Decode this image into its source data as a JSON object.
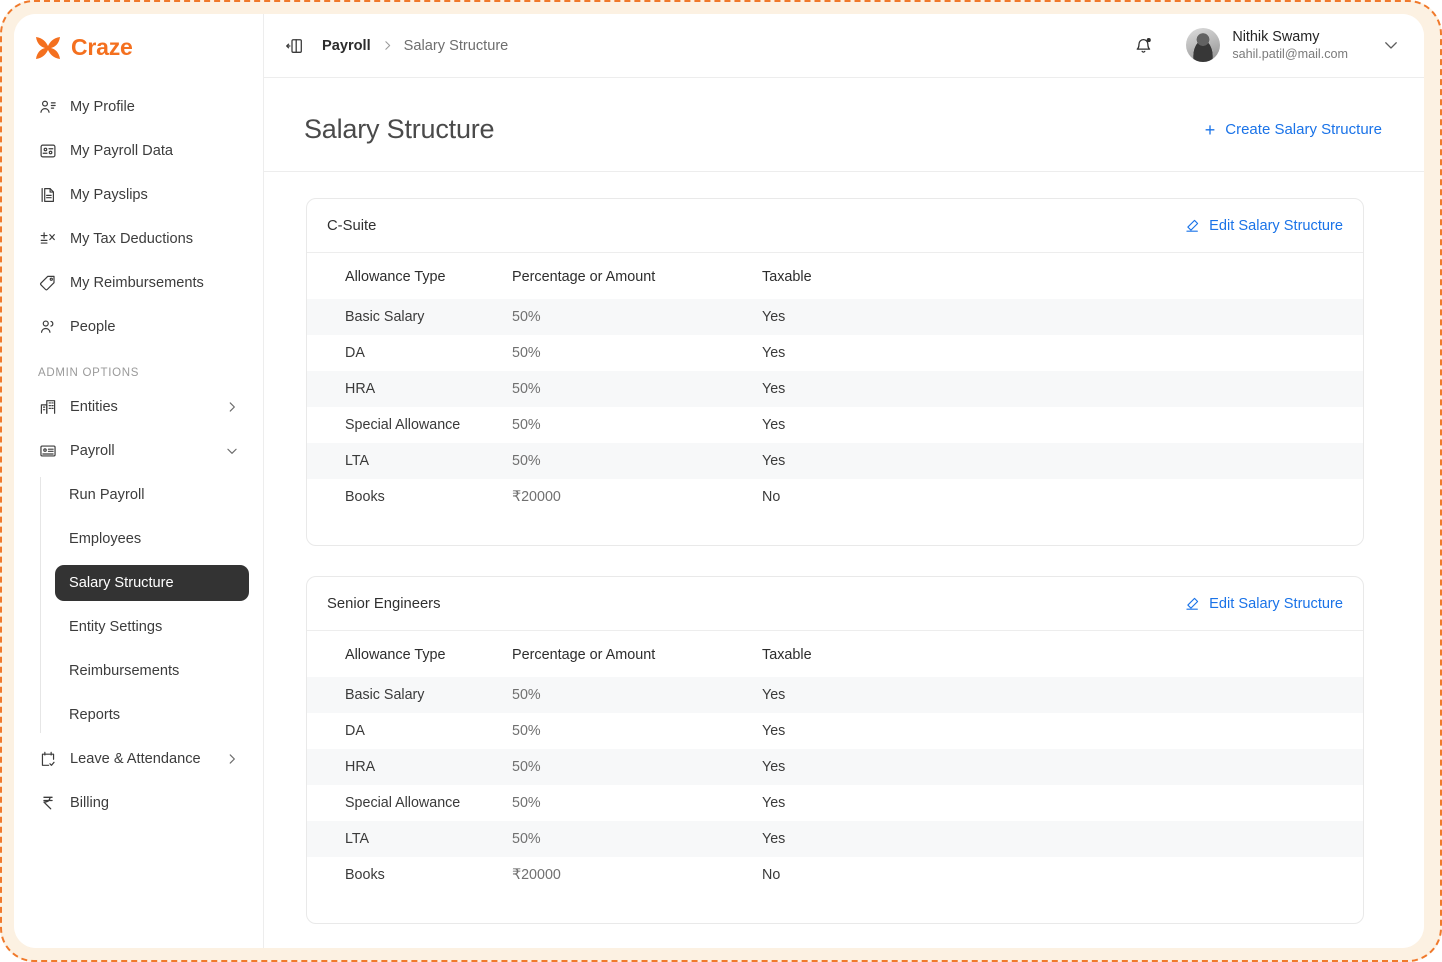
{
  "brand": {
    "name": "Craze",
    "color": "#f4701f",
    "logo_icon": "craze-x-logo"
  },
  "sidebar": {
    "items": [
      {
        "label": "My Profile",
        "icon": "user-profile-icon"
      },
      {
        "label": "My Payroll Data",
        "icon": "id-card-icon"
      },
      {
        "label": "My Payslips",
        "icon": "documents-icon"
      },
      {
        "label": "My Tax Deductions",
        "icon": "tax-calculator-icon"
      },
      {
        "label": "My Reimbursements",
        "icon": "tag-icon"
      },
      {
        "label": "People",
        "icon": "people-icon"
      }
    ],
    "section_label": "ADMIN OPTIONS",
    "admin_items": [
      {
        "label": "Entities",
        "icon": "building-icon",
        "expander": "chevron-right-icon"
      },
      {
        "label": "Payroll",
        "icon": "payroll-card-icon",
        "expander": "chevron-down-icon"
      }
    ],
    "payroll_children": [
      {
        "label": "Run Payroll",
        "active": false
      },
      {
        "label": "Employees",
        "active": false
      },
      {
        "label": "Salary Structure",
        "active": true
      },
      {
        "label": "Entity Settings",
        "active": false
      },
      {
        "label": "Reimbursements",
        "active": false
      },
      {
        "label": "Reports",
        "active": false
      }
    ],
    "bottom_items": [
      {
        "label": "Leave & Attendance",
        "icon": "calendar-check-icon",
        "expander": "chevron-right-icon"
      },
      {
        "label": "Billing",
        "icon": "rupee-icon",
        "expander": ""
      }
    ]
  },
  "topbar": {
    "collapse_icon": "panel-collapse-icon",
    "breadcrumb": {
      "parent": "Payroll",
      "separator": "chevron-right-icon",
      "current": "Salary Structure"
    },
    "notifications_icon": "bell-icon",
    "has_unread": true,
    "user": {
      "name": "Nithik Swamy",
      "email": "sahil.patil@mail.com",
      "avatar": "user-avatar",
      "caret_icon": "chevron-down-icon"
    }
  },
  "page": {
    "title": "Salary Structure",
    "create_button": {
      "label": "Create Salary Structure",
      "icon": "plus-icon",
      "color": "#1a73e8"
    }
  },
  "table_headers": [
    "Allowance Type",
    "Percentage or Amount",
    "Taxable"
  ],
  "edit_button_label": "Edit Salary Structure",
  "edit_button_icon": "pencil-icon",
  "structures": [
    {
      "name": "C-Suite",
      "rows": [
        {
          "allowance": "Basic Salary",
          "value": "50%",
          "taxable": "Yes"
        },
        {
          "allowance": "DA",
          "value": "50%",
          "taxable": "Yes"
        },
        {
          "allowance": "HRA",
          "value": "50%",
          "taxable": "Yes"
        },
        {
          "allowance": "Special Allowance",
          "value": "50%",
          "taxable": "Yes"
        },
        {
          "allowance": "LTA",
          "value": "50%",
          "taxable": "Yes"
        },
        {
          "allowance": "Books",
          "value": "₹20000",
          "taxable": "No"
        }
      ]
    },
    {
      "name": "Senior Engineers",
      "rows": [
        {
          "allowance": "Basic Salary",
          "value": "50%",
          "taxable": "Yes"
        },
        {
          "allowance": "DA",
          "value": "50%",
          "taxable": "Yes"
        },
        {
          "allowance": "HRA",
          "value": "50%",
          "taxable": "Yes"
        },
        {
          "allowance": "Special Allowance",
          "value": "50%",
          "taxable": "Yes"
        },
        {
          "allowance": "LTA",
          "value": "50%",
          "taxable": "Yes"
        },
        {
          "allowance": "Books",
          "value": "₹20000",
          "taxable": "No"
        }
      ]
    }
  ]
}
